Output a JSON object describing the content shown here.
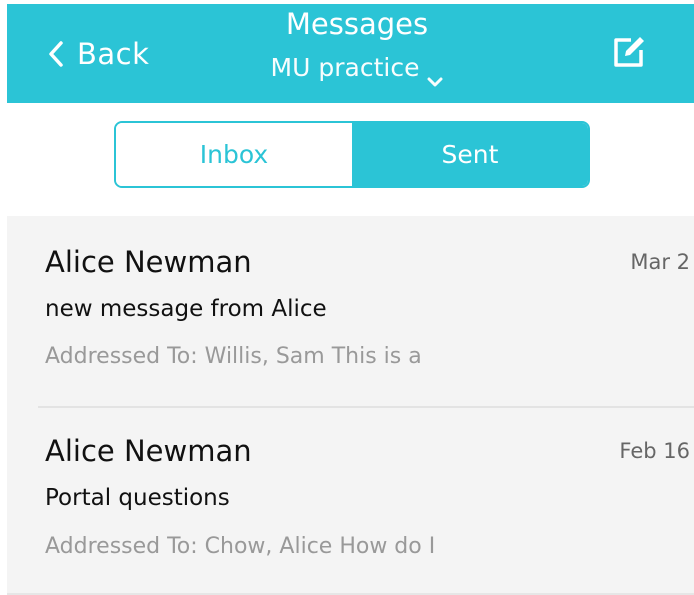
{
  "header": {
    "back_label": "Back",
    "title": "Messages",
    "subtitle": "MU practice",
    "compose_icon": "compose-icon"
  },
  "tabs": [
    {
      "label": "Inbox",
      "active": false
    },
    {
      "label": "Sent",
      "active": true
    }
  ],
  "messages": [
    {
      "sender": "Alice Newman",
      "date": "Mar 2",
      "subject": "new message from Alice",
      "preview": "Addressed To: Willis, Sam This is a"
    },
    {
      "sender": "Alice Newman",
      "date": "Feb 16",
      "subject": "Portal questions",
      "preview": "Addressed To: Chow, Alice How do I"
    }
  ],
  "colors": {
    "accent": "#2bc4d6",
    "list_background": "#f4f4f4",
    "preview_text": "#999999"
  }
}
